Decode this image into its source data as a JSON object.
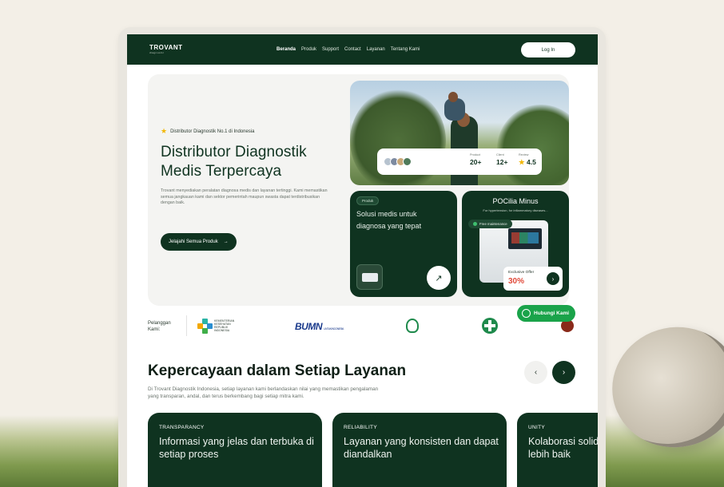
{
  "nav": {
    "logo": "TROVANT",
    "logo_sub": "diagnostic",
    "links": [
      "Beranda",
      "Produk",
      "Support",
      "Contact",
      "Layanan",
      "Tentang Kami"
    ],
    "active_link": "Beranda",
    "login_label": "Log In"
  },
  "hero": {
    "tagline": "Distributor Diagnostik No.1 di Indonesia",
    "title": "Distributor Diagnostik Medis Terpercaya",
    "description": "Trovant menyediakan peralatan diagnosa medis dan layanan tertinggi. Kami memastikan semua jangkauan kami dan sektor pemerintah maupun swasta dapat terdistribusikan dengan baik.",
    "cta_label": "Jelajahi Semua Produk",
    "stats": [
      {
        "label": "Product",
        "value": "20+"
      },
      {
        "label": "Client",
        "value": "12+"
      },
      {
        "label": "Review",
        "value": "4.5"
      }
    ]
  },
  "card_solusi": {
    "tag": "Produk",
    "text": "Solusi medis untuk diagnosa yang tepat"
  },
  "card_pocilia": {
    "title": "POCilia Minus",
    "subtitle": "For hypertension, for inflammatory diseases...",
    "chip": "Free maintenance",
    "offer_label": "Exclusive Offer",
    "offer_value": "30%"
  },
  "clients": {
    "label": "Pelanggan Kami:",
    "kemenkes_text": "KEMENTERIAN KESEHATAN REPUBLIK INDONESIA",
    "bumn_text": "BUMN",
    "bumn_sub": "UNTUK INDONESIA"
  },
  "whatsapp_label": "Hubungi Kami",
  "section2": {
    "title": "Kepercayaan dalam Setiap Layanan",
    "description": "Di Trovant Diagnostik Indonesia, setiap layanan kami berlandaskan nilai yang memastikan pengalaman yang transparan, andal, dan terus berkembang bagi setiap mitra kami.",
    "cards": [
      {
        "kicker": "TRANSPARANCY",
        "heading": "Informasi yang jelas dan terbuka di setiap proses"
      },
      {
        "kicker": "RELIABILITY",
        "heading": "Layanan yang konsisten dan dapat diandalkan"
      },
      {
        "kicker": "UNITY",
        "heading": "Kolaborasi solid lebih baik"
      }
    ]
  },
  "colors": {
    "primary": "#0f3320",
    "accent_star": "#f2b705",
    "whatsapp": "#1aa34a",
    "offer_red": "#e04a3a"
  }
}
